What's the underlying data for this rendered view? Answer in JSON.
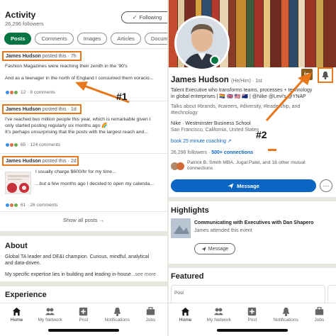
{
  "left": {
    "activity": {
      "title": "Activity",
      "followers": "26,296 followers",
      "following_label": "Following"
    },
    "chips": [
      "Posts",
      "Comments",
      "Images",
      "Articles",
      "Document"
    ],
    "posts": [
      {
        "author": "James Hudson",
        "posted": "posted this",
        "time": "7h",
        "lines": [
          "Fashion Magazines were reaching their zenith in the '90's",
          "And as a teenager in the north of England I consumed them voracio..."
        ],
        "reactions": "12",
        "comments": "8 comments"
      },
      {
        "author": "James Hudson",
        "posted": "posted this",
        "time": "1d",
        "lines": [
          "I've reached two million people this year, which is remarkable given I",
          "only started posting regularly six months ago 🌈",
          "It's perhaps unsurprising that the posts with the largest reach and..."
        ],
        "reactions": "65",
        "comments": "124 comments"
      },
      {
        "author": "James Hudson",
        "posted": "posted this",
        "time": "2d",
        "lines": [
          "I usually charge $600/hr for my time...",
          "...but a few months ago I decided to open my calenda..."
        ],
        "reactions": "61",
        "comments": "26 comments"
      }
    ],
    "show_all": "Show all posts →",
    "about": {
      "title": "About",
      "lines": [
        "Global TA leader and DE&I champion. Curious, mindful, analytical",
        "and data-driven.",
        "My specific expertise lies in building and leading in-house"
      ],
      "see_more": "...see more"
    },
    "experience_title": "Experience",
    "annotation": "#1"
  },
  "right": {
    "name": "James Hudson",
    "pronouns": "(He/Him) · 1st",
    "headline": [
      "Talent Executive who transforms teams, processes + technology",
      "in global enterprises | 🏳️‍🌈 🇬🇧 🇺🇸 🇳🇿 | @Nike @Levi's @YNAP"
    ],
    "talks": [
      "Talks about #brands, #careers, #diversity, #leadership, and",
      "#technology"
    ],
    "edu": "Nike · Westminster Business School",
    "location": "San Francisco, California, United States",
    "booking": "book 25 minute coaching ↗",
    "followers": "26,296 followers",
    "connections": "500+ connections",
    "mutual": [
      "Patrick B. Smith MBA, Jugal Patel, and 16 other mutual",
      "connections"
    ],
    "message_label": "Message",
    "more_label": "···",
    "highlights": {
      "title": "Highlights",
      "event": "Communicating with Executives with Dan Shapero",
      "attended": "James attended this event",
      "message_label": "Message"
    },
    "featured": {
      "title": "Featured",
      "post_label": "Post"
    },
    "linkedin_badge": "in",
    "annotation": "#2"
  },
  "nav": [
    {
      "label": "Home",
      "icon": "home-icon"
    },
    {
      "label": "My Network",
      "icon": "network-icon"
    },
    {
      "label": "Post",
      "icon": "post-icon"
    },
    {
      "label": "Notifications",
      "icon": "bell-icon"
    },
    {
      "label": "Jobs",
      "icon": "briefcase-icon"
    }
  ],
  "colors": {
    "accent": "#057642",
    "linkedin_blue": "#0a66c2",
    "highlight_orange": "#e8761b"
  }
}
